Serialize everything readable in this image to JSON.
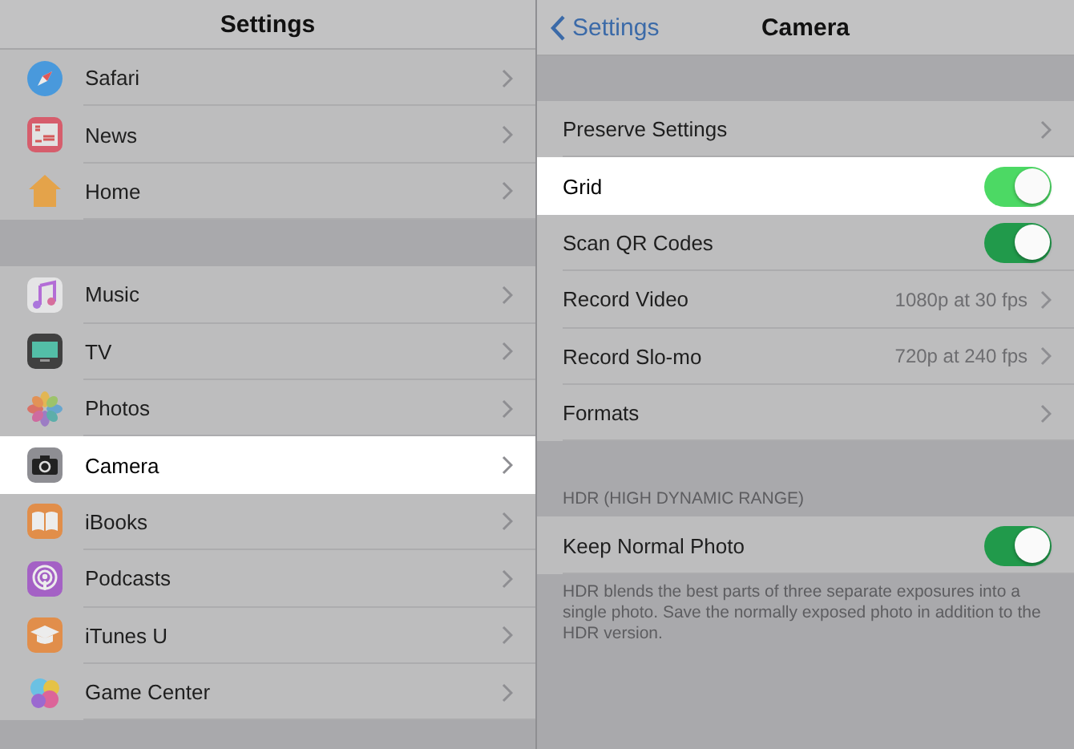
{
  "master": {
    "title": "Settings",
    "groups": [
      [
        {
          "label": "Safari",
          "selected": false
        },
        {
          "label": "News",
          "selected": false
        },
        {
          "label": "Home",
          "selected": false
        }
      ],
      [
        {
          "label": "Music",
          "selected": false
        },
        {
          "label": "TV",
          "selected": false
        },
        {
          "label": "Photos",
          "selected": false
        },
        {
          "label": "Camera",
          "selected": true
        },
        {
          "label": "iBooks",
          "selected": false
        },
        {
          "label": "Podcasts",
          "selected": false
        },
        {
          "label": "iTunes U",
          "selected": false
        },
        {
          "label": "Game Center",
          "selected": false
        }
      ]
    ]
  },
  "detail": {
    "back": "Settings",
    "title": "Camera",
    "rows": [
      {
        "kind": "link",
        "label": "Preserve Settings",
        "highlighted": false
      },
      {
        "kind": "toggle",
        "label": "Grid",
        "on": true,
        "highlighted": true
      },
      {
        "kind": "toggle",
        "label": "Scan QR Codes",
        "on": true,
        "highlighted": false
      },
      {
        "kind": "link",
        "label": "Record Video",
        "value": "1080p at 30 fps",
        "highlighted": false
      },
      {
        "kind": "link",
        "label": "Record Slo-mo",
        "value": "720p at 240 fps",
        "highlighted": false
      },
      {
        "kind": "link",
        "label": "Formats",
        "highlighted": false
      }
    ],
    "hdr": {
      "header": "HDR (HIGH DYNAMIC RANGE)",
      "rows": [
        {
          "kind": "toggle",
          "label": "Keep Normal Photo",
          "on": true,
          "highlighted": false
        }
      ],
      "footer": "HDR blends the best parts of three separate exposures into a single photo. Save the normally exposed photo in addition to the HDR version."
    }
  }
}
